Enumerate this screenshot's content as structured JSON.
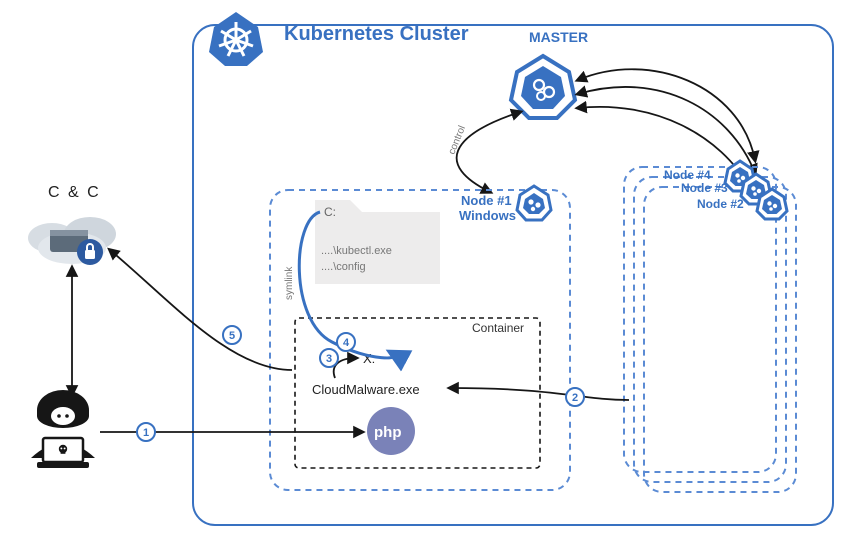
{
  "title": "Kubernetes Cluster",
  "cc_label": "C & C",
  "master_label": "MASTER",
  "control_edge_label": "control",
  "symlink_edge_label": "symlink",
  "nodes": {
    "node1_line1": "Node #1",
    "node1_line2": "Windows",
    "node2": "Node #2",
    "node3": "Node #3",
    "node4": "Node #4"
  },
  "file_view": {
    "drive": "C:",
    "line1": "....\\kubectl.exe",
    "line2": "....\\config"
  },
  "container": {
    "label": "Container",
    "mount": "X:",
    "malware": "CloudMalware.exe",
    "runtime": "php"
  },
  "steps": {
    "s1": "1",
    "s2": "2",
    "s3": "3",
    "s4": "4",
    "s5": "5"
  },
  "colors": {
    "k8s_blue": "#3871c1",
    "k8s_blue_dark": "#2d5aa0",
    "grey_fill": "#edecec",
    "php_fill": "#7a82b8",
    "dash_blue": "#5b8bd4",
    "black": "#161616"
  }
}
